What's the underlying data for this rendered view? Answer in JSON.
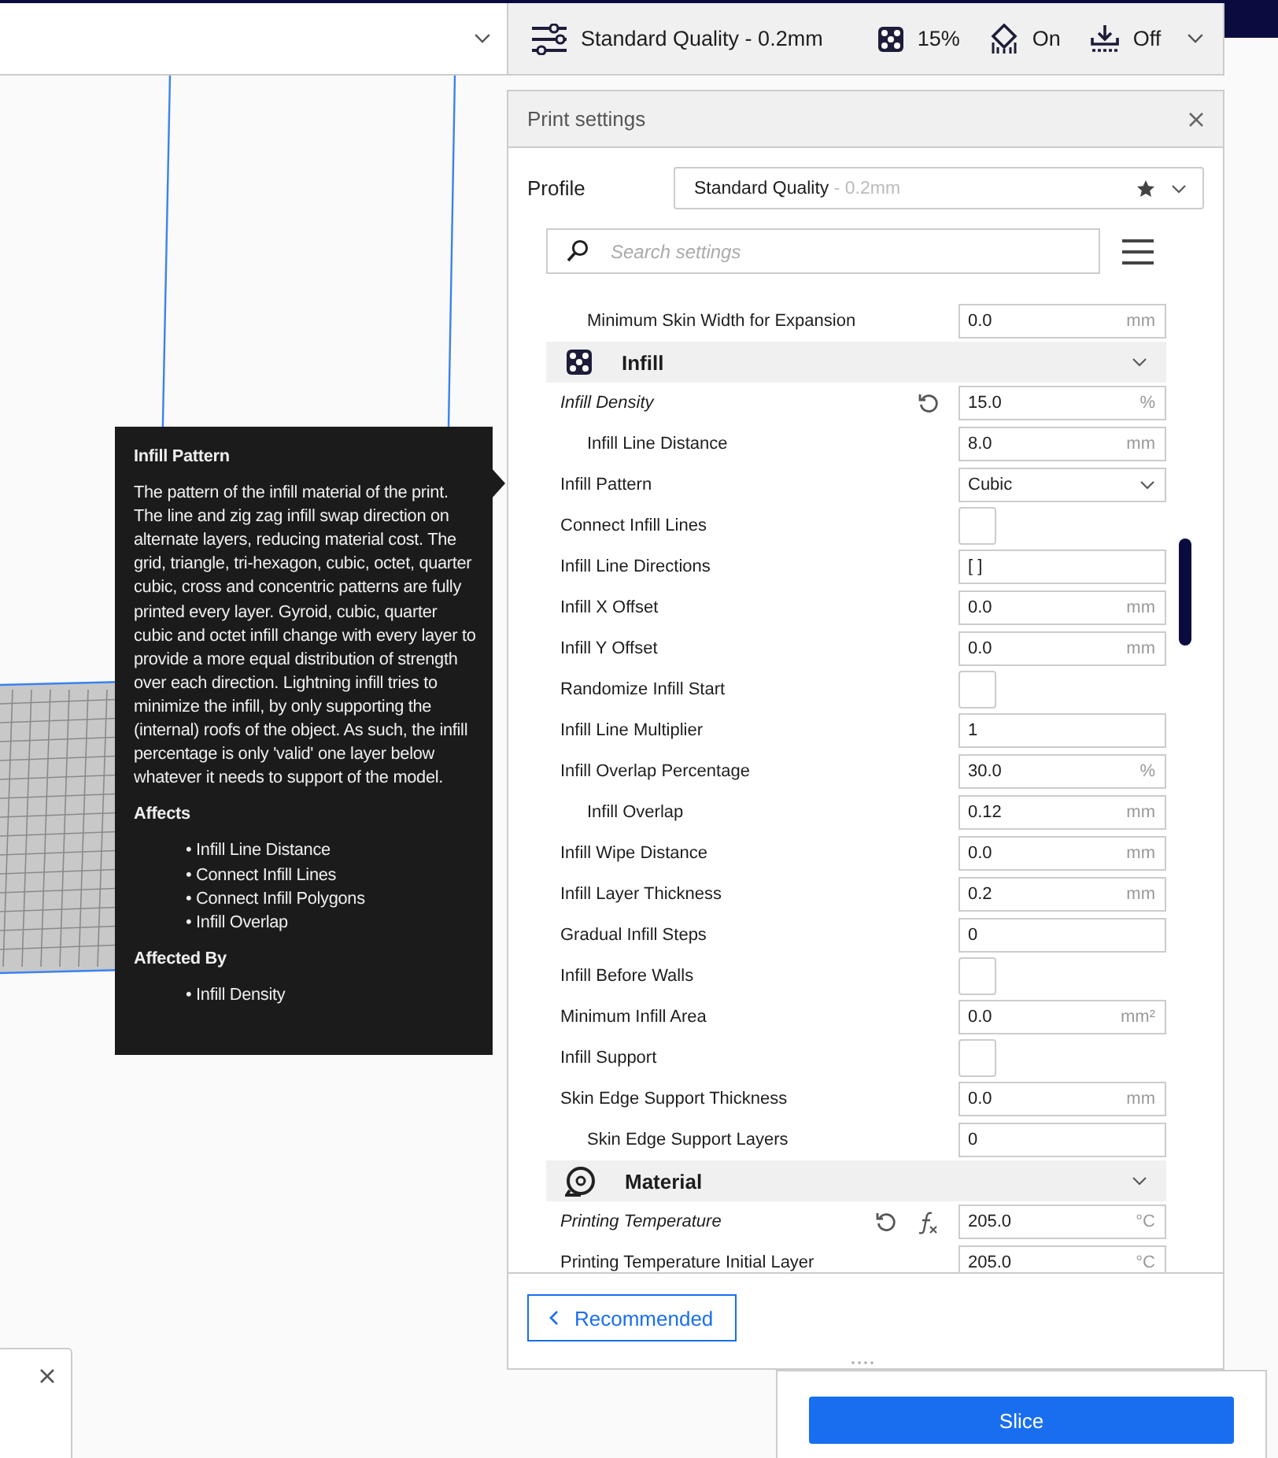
{
  "top_bar": {
    "quality": {
      "profile": "Standard Quality - 0.2mm",
      "infill": "15%",
      "support": "On",
      "adhesion": "Off"
    }
  },
  "tooltip": {
    "title": "Infill Pattern",
    "body": "The pattern of the infill material of the print. The line and zig zag infill swap direction on alternate layers, reducing material cost. The grid, triangle, tri-hexagon, cubic, octet, quarter cubic, cross and concentric patterns are fully printed every layer. Gyroid, cubic, quarter cubic and octet infill change with every layer to provide a more equal distribution of strength over each direction. Lightning infill tries to minimize the infill, by only supporting the (internal) roofs of the object. As such, the infill percentage is only 'valid' one layer below whatever it needs to support of the model.",
    "sections": [
      {
        "title": "Affects",
        "items": [
          "• Infill Line Distance",
          "• Connect Infill Lines",
          "• Connect Infill Polygons",
          "• Infill Overlap"
        ]
      },
      {
        "title": "Affected By",
        "items": [
          "• Infill Density"
        ]
      }
    ]
  },
  "print_settings": {
    "title": "Print settings",
    "profile": {
      "label": "Profile",
      "name": "Standard Quality",
      "suffix": " - 0.2mm"
    },
    "search": {
      "placeholder": "Search settings"
    },
    "continued_children": [
      {
        "kind": "number",
        "label": "Minimum Skin Width for Expansion",
        "value": "0.0",
        "unit": "mm",
        "modified": false,
        "formula": false
      }
    ],
    "categories": [
      {
        "label": "Infill",
        "expanded": true,
        "settings": [
          {
            "kind": "number",
            "label": "Infill Density",
            "value": "15.0",
            "unit": "%",
            "modified": true,
            "formula": false,
            "children": [
              {
                "kind": "number",
                "label": "Infill Line Distance",
                "value": "8.0",
                "unit": "mm",
                "modified": false,
                "formula": false
              }
            ]
          },
          {
            "kind": "select",
            "label": "Infill Pattern",
            "value": "Cubic",
            "modified": false,
            "formula": false
          },
          {
            "kind": "checkbox",
            "label": "Connect Infill Lines",
            "checked": false,
            "modified": false,
            "formula": false
          },
          {
            "kind": "number",
            "label": "Infill Line Directions",
            "value": "[ ]",
            "modified": false,
            "formula": false
          },
          {
            "kind": "number",
            "label": "Infill X Offset",
            "value": "0.0",
            "unit": "mm",
            "modified": false,
            "formula": false
          },
          {
            "kind": "number",
            "label": "Infill Y Offset",
            "value": "0.0",
            "unit": "mm",
            "modified": false,
            "formula": false
          },
          {
            "kind": "checkbox",
            "label": "Randomize Infill Start",
            "checked": false,
            "modified": false,
            "formula": false
          },
          {
            "kind": "number",
            "label": "Infill Line Multiplier",
            "value": "1",
            "modified": false,
            "formula": false
          },
          {
            "kind": "number",
            "label": "Infill Overlap Percentage",
            "value": "30.0",
            "unit": "%",
            "modified": false,
            "formula": false,
            "children": [
              {
                "kind": "number",
                "label": "Infill Overlap",
                "value": "0.12",
                "unit": "mm",
                "modified": false,
                "formula": false
              }
            ]
          },
          {
            "kind": "number",
            "label": "Infill Wipe Distance",
            "value": "0.0",
            "unit": "mm",
            "modified": false,
            "formula": false
          },
          {
            "kind": "number",
            "label": "Infill Layer Thickness",
            "value": "0.2",
            "unit": "mm",
            "modified": false,
            "formula": false
          },
          {
            "kind": "number",
            "label": "Gradual Infill Steps",
            "value": "0",
            "modified": false,
            "formula": false
          },
          {
            "kind": "checkbox",
            "label": "Infill Before Walls",
            "checked": false,
            "modified": false,
            "formula": false
          },
          {
            "kind": "number",
            "label": "Minimum Infill Area",
            "value": "0.0",
            "unit": "mm²",
            "modified": false,
            "formula": false
          },
          {
            "kind": "checkbox",
            "label": "Infill Support",
            "checked": false,
            "modified": false,
            "formula": false
          },
          {
            "kind": "number",
            "label": "Skin Edge Support Thickness",
            "value": "0.0",
            "unit": "mm",
            "modified": false,
            "formula": false,
            "children": [
              {
                "kind": "number",
                "label": "Skin Edge Support Layers",
                "value": "0",
                "modified": false,
                "formula": false
              }
            ]
          }
        ]
      },
      {
        "label": "Material",
        "expanded": true,
        "settings": [
          {
            "kind": "number",
            "label": "Printing Temperature",
            "value": "205.0",
            "unit": "°C",
            "modified": true,
            "formula": true
          },
          {
            "kind": "number",
            "label": "Printing Temperature Initial Layer",
            "value": "205.0",
            "unit": "°C",
            "modified": false,
            "formula": false
          }
        ]
      }
    ],
    "recommended_button": "Recommended"
  },
  "slice_button": "Slice"
}
